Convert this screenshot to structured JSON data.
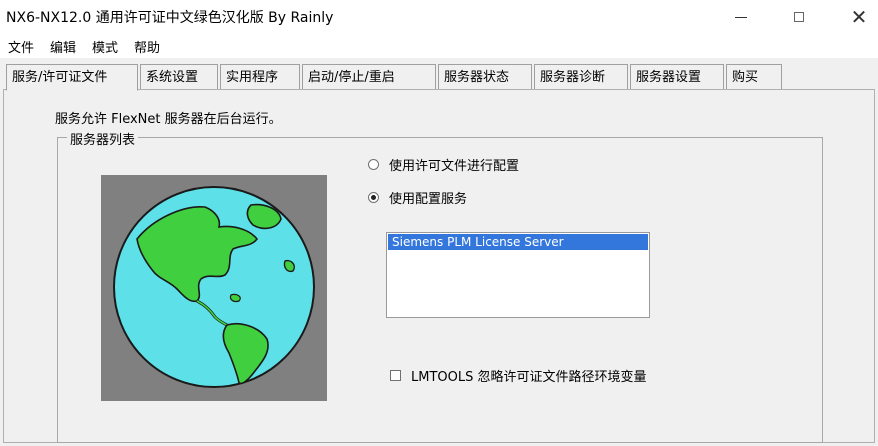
{
  "window": {
    "title": "NX6-NX12.0 通用许可证中文绿色汉化版 By Rainly"
  },
  "menu": {
    "items": [
      "文件",
      "编辑",
      "模式",
      "帮助"
    ]
  },
  "tabs": [
    {
      "label": "服务/许可证文件",
      "active": true
    },
    {
      "label": "系统设置"
    },
    {
      "label": "实用程序"
    },
    {
      "label": "启动/停止/重启"
    },
    {
      "label": "服务器状态"
    },
    {
      "label": "服务器诊断"
    },
    {
      "label": "服务器设置"
    },
    {
      "label": "购买"
    }
  ],
  "panel": {
    "description": "服务允许 FlexNet 服务器在后台运行。",
    "group_label": "服务器列表",
    "radio_license_file": "使用许可文件进行配置",
    "radio_services": "使用配置服务",
    "selected_radio": "radio_services",
    "list_items": [
      "Siemens PLM License Server"
    ],
    "checkbox_label": "LMTOOLS 忽略许可证文件路径环境变量",
    "checkbox_checked": false
  },
  "colors": {
    "globe_ocean": "#5ee0e8",
    "globe_land": "#3fcf3f",
    "globe_box_bg": "#808080",
    "selection": "#3377dd"
  }
}
